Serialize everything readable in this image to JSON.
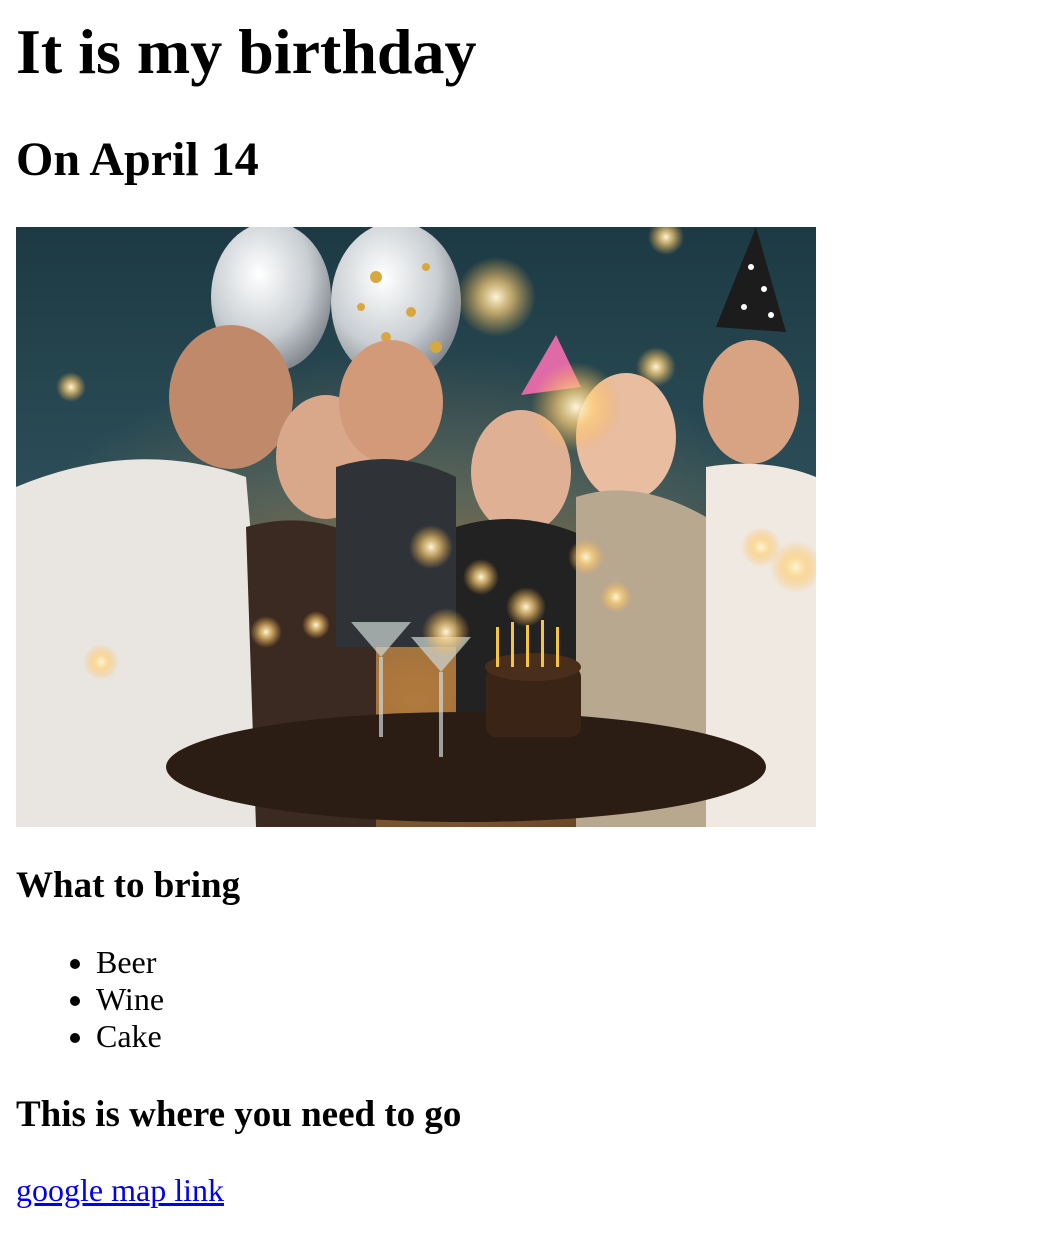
{
  "title": "It is my birthday",
  "date_heading": "On April 14",
  "photo": {
    "icon": "birthday-party-photo"
  },
  "bring": {
    "heading": "What to bring",
    "items": [
      "Beer",
      "Wine",
      "Cake"
    ]
  },
  "where": {
    "heading": "This is where you need to go",
    "link_text": "google map link"
  },
  "colors": {
    "link": "#0000ee",
    "text": "#000000",
    "background": "#ffffff"
  }
}
